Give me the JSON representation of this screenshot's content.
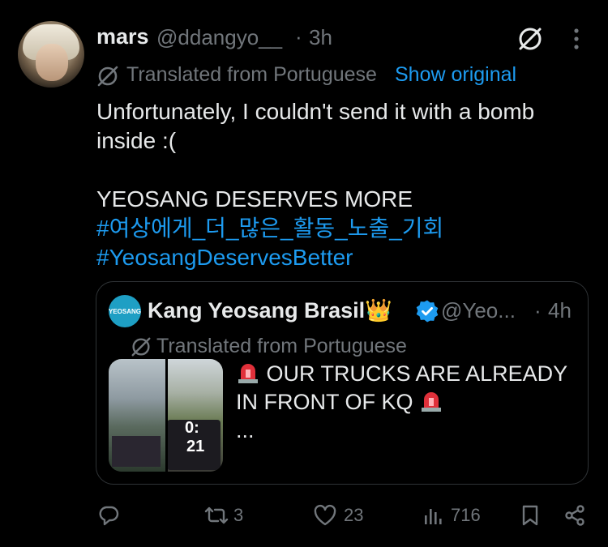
{
  "post": {
    "author_name": "mars",
    "author_handle": "@ddangyo__",
    "separator": "·",
    "time": "3h",
    "translated_label": "Translated from Portuguese",
    "show_original": "Show original",
    "text_line1": "Unfortunately, I couldn't send it with a bomb",
    "text_line2": "inside :(",
    "text_line3": "YEOSANG DESERVES MORE",
    "hashtag1": "#여상에게_더_많은_활동_노출_기회",
    "hashtag2": "#YeosangDeservesBetter"
  },
  "quote": {
    "avatar_text": "YEOSANG",
    "author_name": "Kang Yeosang Brasil",
    "crown_emoji": "👑",
    "author_handle": "@Yeo...",
    "separator": "·",
    "time": "4h",
    "translated_label": "Translated from Portuguese",
    "text_line1": "OUR TRUCKS ARE ALREADY",
    "text_line2": "IN FRONT OF KQ",
    "ellipsis": "...",
    "video_timer_1": "0:",
    "video_timer_2": "21"
  },
  "actions": {
    "reply_count": "",
    "repost_count": "3",
    "like_count": "23",
    "views_count": "716"
  },
  "colors": {
    "background": "#000000",
    "text": "#e7e9ea",
    "muted": "#71767b",
    "link": "#1d9bf0",
    "verified": "#1d9bf0"
  }
}
